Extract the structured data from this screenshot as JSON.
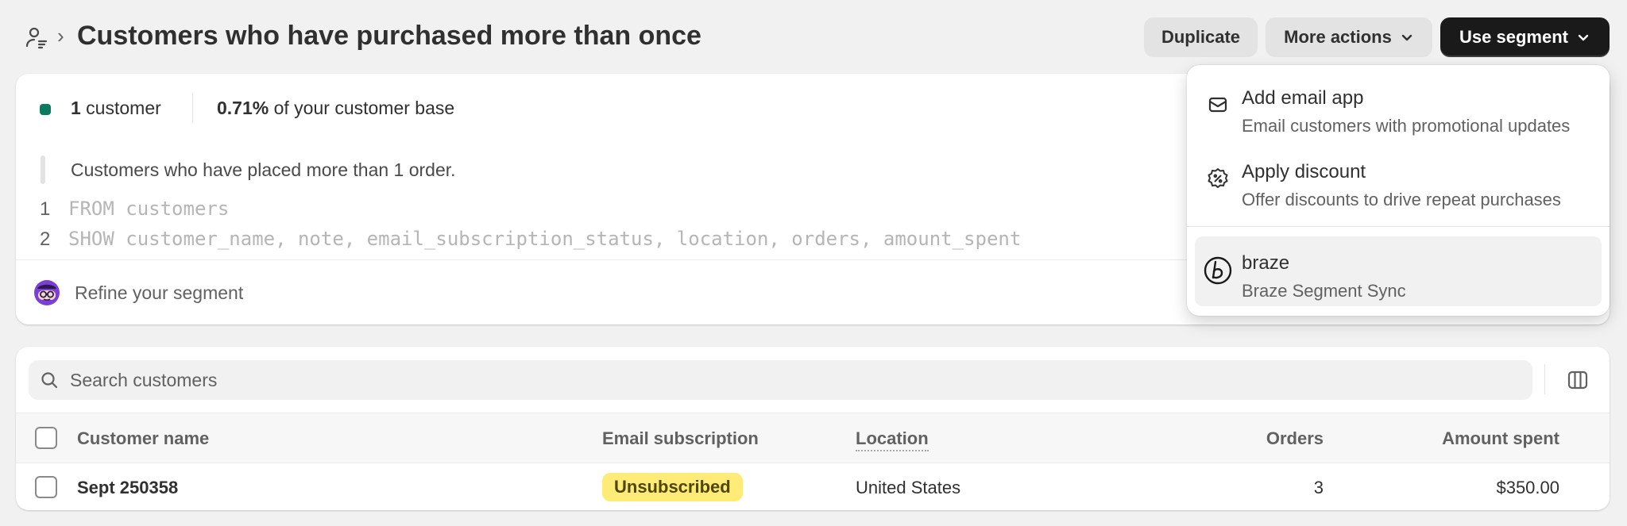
{
  "header": {
    "title": "Customers who have purchased more than once",
    "breadcrumb_separator": "›",
    "duplicate_label": "Duplicate",
    "more_actions_label": "More actions",
    "use_segment_label": "Use segment"
  },
  "summary": {
    "count_number": "1",
    "count_unit": " customer",
    "percent_value": "0.71%",
    "percent_suffix": " of your customer base",
    "description": "Customers who have placed more than 1 order.",
    "code_lines": [
      {
        "num": "1",
        "code": "FROM customers"
      },
      {
        "num": "2",
        "code": "SHOW customer_name, note, email_subscription_status, location, orders, amount_spent"
      }
    ],
    "refine_label": "Refine your segment"
  },
  "menu": {
    "items": [
      {
        "title": "Add email app",
        "subtitle": "Email customers with promotional updates",
        "icon": "mail-icon"
      },
      {
        "title": "Apply discount",
        "subtitle": "Offer discounts to drive repeat purchases",
        "icon": "discount-icon"
      },
      {
        "title": "braze",
        "subtitle": "Braze Segment Sync",
        "icon": "braze-logo-icon"
      }
    ]
  },
  "table": {
    "search_placeholder": "Search customers",
    "columns": [
      "Customer name",
      "Email subscription",
      "Location",
      "Orders",
      "Amount spent"
    ],
    "rows": [
      {
        "name": "Sept 250358",
        "email_subscription": "Unsubscribed",
        "location": "United States",
        "orders": "3",
        "amount_spent": "$350.00"
      }
    ]
  },
  "colors": {
    "primary_button": "#1a1a1a",
    "status_dot": "#0c7a5d",
    "badge_unsubscribed": "#ffeb78"
  }
}
